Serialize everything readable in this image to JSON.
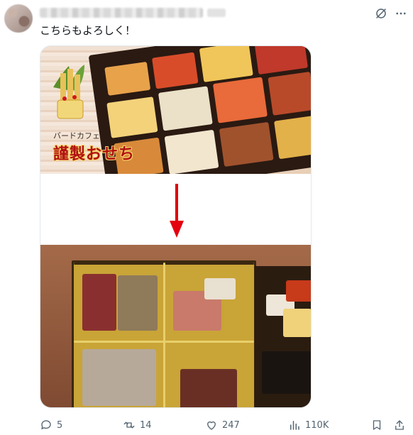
{
  "tweet": {
    "text": "こちらもよろしく！"
  },
  "media": {
    "top_caption_small": "バードカフェ",
    "top_caption_large": "謹製おせち"
  },
  "actions": {
    "replies": "5",
    "reposts": "14",
    "likes": "247",
    "views": "110K"
  },
  "icons": {
    "grok": "grok-icon",
    "more": "more-icon",
    "reply": "reply-icon",
    "repost": "repost-icon",
    "like": "heart-icon",
    "views": "views-icon",
    "bookmark": "bookmark-icon",
    "share": "share-icon"
  },
  "colors": {
    "text": "#0f1419",
    "muted": "#536471",
    "arrow": "#e3000f"
  }
}
